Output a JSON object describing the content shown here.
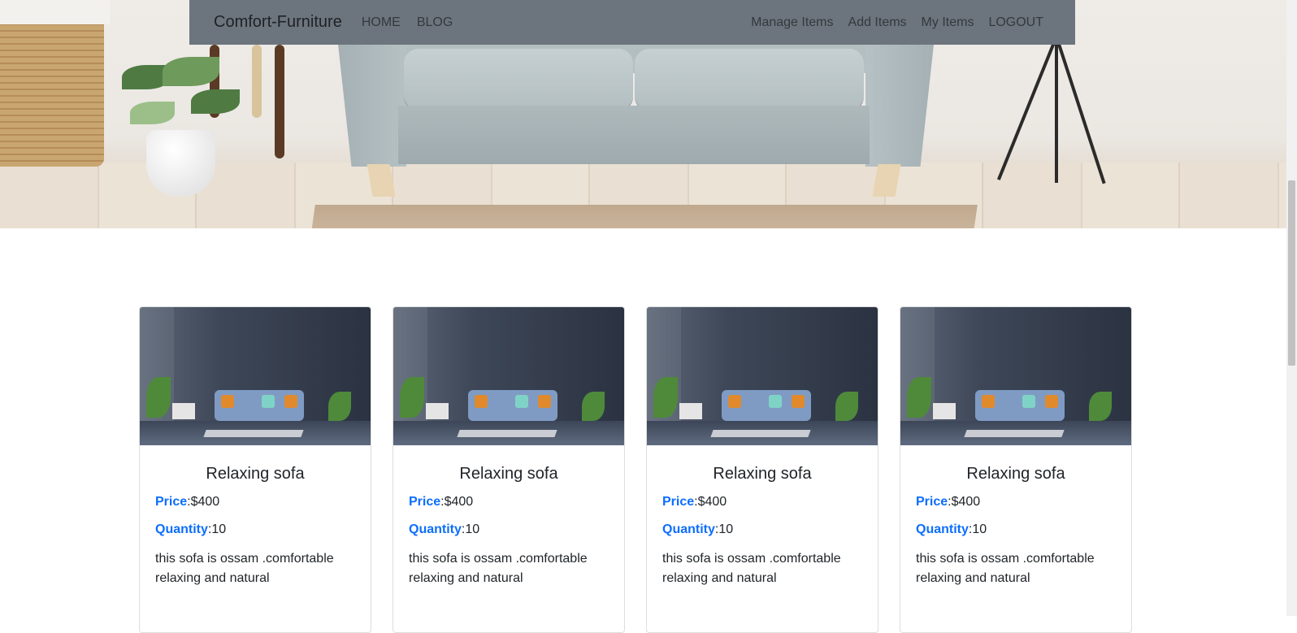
{
  "navbar": {
    "brand": "Comfort-Furniture",
    "left_links": [
      "HOME",
      "BLOG"
    ],
    "right_links": [
      "Manage Items",
      "Add Items",
      "My Items",
      "LOGOUT"
    ]
  },
  "cards": [
    {
      "title": "Relaxing sofa",
      "price_label": "Price",
      "price": ":$400",
      "qty_label": "Quantity",
      "qty": ":10",
      "description": "this sofa is ossam .comfortable relaxing and natural"
    },
    {
      "title": "Relaxing sofa",
      "price_label": "Price",
      "price": ":$400",
      "qty_label": "Quantity",
      "qty": ":10",
      "description": "this sofa is ossam .comfortable relaxing and natural"
    },
    {
      "title": "Relaxing sofa",
      "price_label": "Price",
      "price": ":$400",
      "qty_label": "Quantity",
      "qty": ":10",
      "description": "this sofa is ossam .comfortable relaxing and natural"
    },
    {
      "title": "Relaxing sofa",
      "price_label": "Price",
      "price": ":$400",
      "qty_label": "Quantity",
      "qty": ":10",
      "description": "this sofa is ossam .comfortable relaxing and natural"
    }
  ],
  "colors": {
    "navbar_bg": "#6c757d",
    "label_accent": "#0d6efd"
  }
}
